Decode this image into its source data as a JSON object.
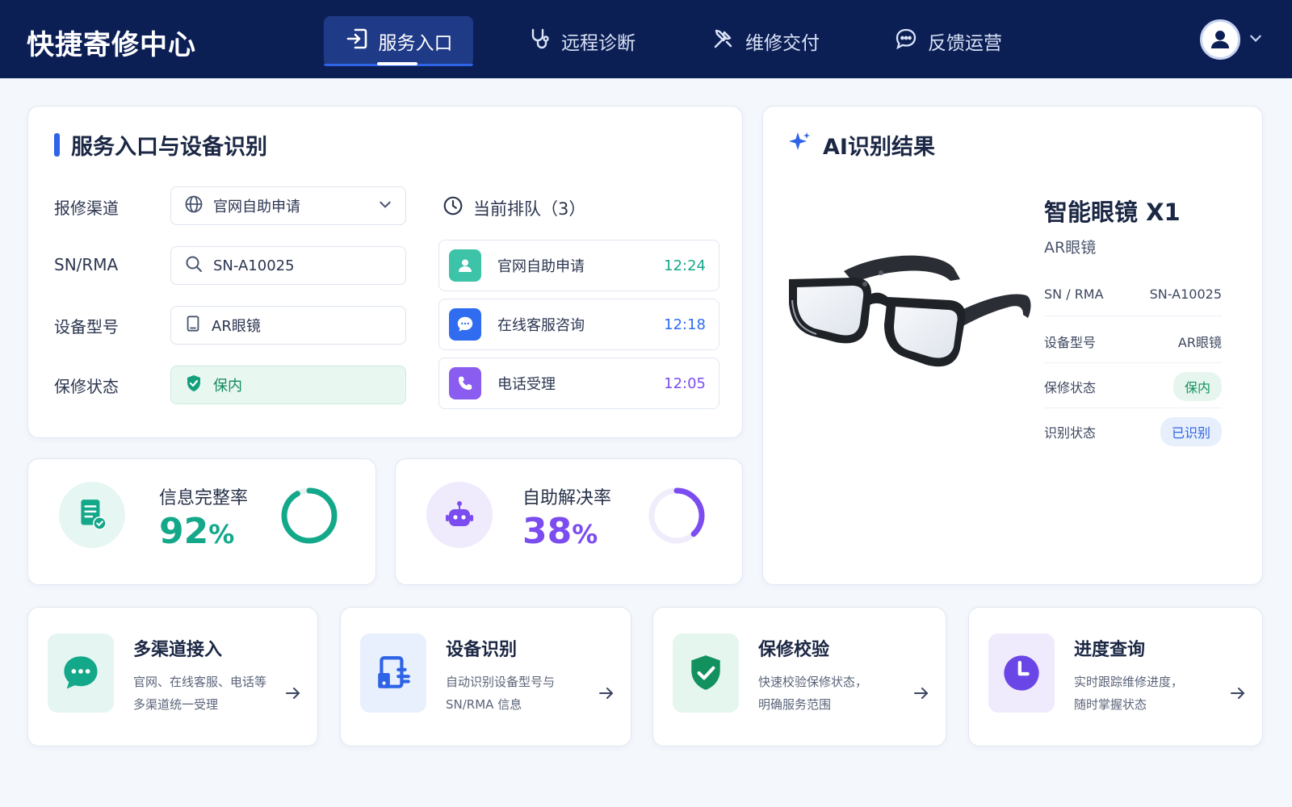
{
  "app": {
    "title": "快捷寄修中心"
  },
  "nav": {
    "items": [
      {
        "label": "服务入口",
        "icon": "login-icon",
        "active": true
      },
      {
        "label": "远程诊断",
        "icon": "stethoscope-icon",
        "active": false
      },
      {
        "label": "维修交付",
        "icon": "tools-icon",
        "active": false
      },
      {
        "label": "反馈运营",
        "icon": "chat-bubble-icon",
        "active": false
      }
    ]
  },
  "service_entry": {
    "title": "服务入口与设备识别",
    "form": [
      {
        "label": "报修渠道",
        "value": "官网自助申请",
        "icon": "globe-icon",
        "type": "select"
      },
      {
        "label": "SN/RMA",
        "value": "SN-A10025",
        "icon": "search-icon",
        "type": "input"
      },
      {
        "label": "设备型号",
        "value": "AR眼镜",
        "icon": "device-icon",
        "type": "input"
      },
      {
        "label": "保修状态",
        "value": "保内",
        "icon": "shield-check-icon",
        "type": "status"
      }
    ],
    "queue": {
      "title": "当前排队（3）",
      "items": [
        {
          "label": "官网自助申请",
          "time": "12:24",
          "icon": "person-icon",
          "color": "#3cc3a8"
        },
        {
          "label": "在线客服咨询",
          "time": "12:18",
          "icon": "chat-icon",
          "color": "#2f6cf0"
        },
        {
          "label": "电话受理",
          "time": "12:05",
          "icon": "phone-icon",
          "color": "#8a5cf0"
        }
      ]
    }
  },
  "stats": [
    {
      "label": "信息完整率",
      "value": "92",
      "unit": "%",
      "fraction": 0.92,
      "color": "#14a88a",
      "icon": "document-check-icon"
    },
    {
      "label": "自助解决率",
      "value": "38",
      "unit": "%",
      "fraction": 0.38,
      "color": "#7b4df0",
      "icon": "robot-icon"
    }
  ],
  "ai_result": {
    "title": "AI识别结果",
    "device_name": "智能眼镜 X1",
    "device_type": "AR眼镜",
    "rows": [
      {
        "label": "SN / RMA",
        "value": "SN-A10025"
      },
      {
        "label": "设备型号",
        "value": "AR眼镜"
      },
      {
        "label": "保修状态",
        "value": "保内"
      },
      {
        "label": "识别状态",
        "value": "已识别"
      }
    ]
  },
  "features": [
    {
      "title": "多渠道接入",
      "desc_line1": "官网、在线客服、电话等",
      "desc_line2": "多渠道统一受理",
      "icon": "chat-icon"
    },
    {
      "title": "设备识别",
      "desc_line1": "自动识别设备型号与",
      "desc_line2": "SN/RMA 信息",
      "icon": "device-scan-icon"
    },
    {
      "title": "保修校验",
      "desc_line1": "快速校验保修状态，",
      "desc_line2": "明确服务范围",
      "icon": "shield-check-icon"
    },
    {
      "title": "进度查询",
      "desc_line1": "实时跟踪维修进度，",
      "desc_line2": "随时掌握状态",
      "icon": "clock-icon"
    }
  ]
}
